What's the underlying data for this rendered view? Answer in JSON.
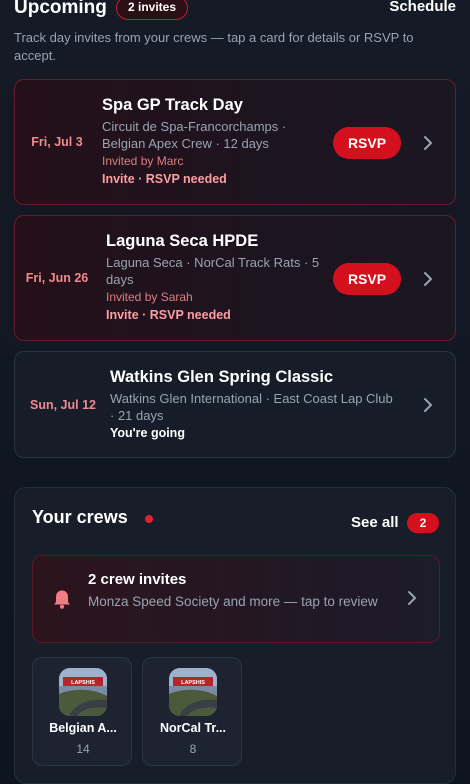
{
  "header": {
    "title": "Upcoming",
    "invites_badge": "2 invites",
    "schedule_link": "Schedule",
    "subtitle": "Track day invites from your crews — tap a card for details or RSVP to accept."
  },
  "events": [
    {
      "date": "Fri, Jul 3",
      "title": "Spa GP Track Day",
      "meta": "Circuit de Spa-Francorchamps · Belgian Apex Crew · 12 days",
      "invited_by": "Invited by Marc",
      "status": "Invite · RSVP needed",
      "action": "RSVP"
    },
    {
      "date": "Fri, Jun 26",
      "title": "Laguna Seca HPDE",
      "meta": "Laguna Seca · NorCal Track Rats · 5 days",
      "invited_by": "Invited by Sarah",
      "status": "Invite · RSVP needed",
      "action": "RSVP"
    },
    {
      "date": "Sun, Jul 12",
      "title": "Watkins Glen Spring Classic",
      "meta": "Watkins Glen International · East Coast Lap Club · 21 days",
      "status": "You're going"
    }
  ],
  "crews": {
    "title": "Your crews",
    "see_all": "See all",
    "see_all_count": "2",
    "invites_card": {
      "title": "2 crew invites",
      "subtitle": "Monza Speed Society and more — tap to review"
    },
    "items": [
      {
        "name": "Belgian A...",
        "count": "14",
        "avatar_label": "LAPSHIS"
      },
      {
        "name": "NorCal Tr...",
        "count": "8",
        "avatar_label": "LAPSHIS"
      }
    ]
  },
  "colors": {
    "accent_red": "#d4101e",
    "invite_border": "#6e1a26",
    "date_pink": "#f08a8e",
    "background": "#141a26"
  },
  "icons": [
    "chevron-right-icon",
    "bell-icon"
  ]
}
